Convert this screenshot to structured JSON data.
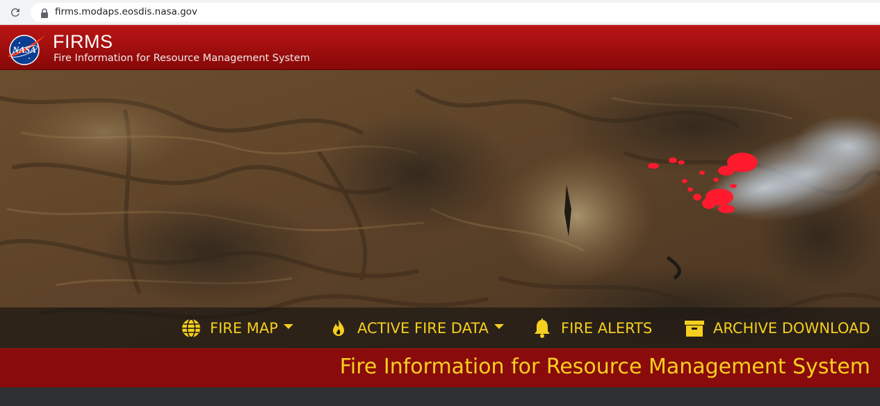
{
  "browser": {
    "url": "firms.modaps.eosdis.nasa.gov",
    "icons": [
      "reload-icon",
      "lock-icon"
    ]
  },
  "header": {
    "logo_text": "NASA",
    "title": "FIRMS",
    "subtitle": "Fire Information for Resource Management System"
  },
  "nav": {
    "items": [
      {
        "label": "FIRE MAP",
        "icon": "globe-icon",
        "has_dropdown": true
      },
      {
        "label": "ACTIVE FIRE DATA",
        "icon": "flame-icon",
        "has_dropdown": true
      },
      {
        "label": "FIRE ALERTS",
        "icon": "bell-icon",
        "has_dropdown": false
      },
      {
        "label": "ARCHIVE DOWNLOAD",
        "icon": "archive-box-icon",
        "has_dropdown": false
      }
    ],
    "color": "#f6cf1f"
  },
  "banner": {
    "text": "Fire Information for Resource Management System"
  },
  "colors": {
    "header_red": "#a30f0f",
    "banner_red": "#8a0b0b",
    "accent_yellow": "#f6cf1f",
    "fire_red": "#ff1a2e",
    "page_bg": "#2f3033"
  }
}
